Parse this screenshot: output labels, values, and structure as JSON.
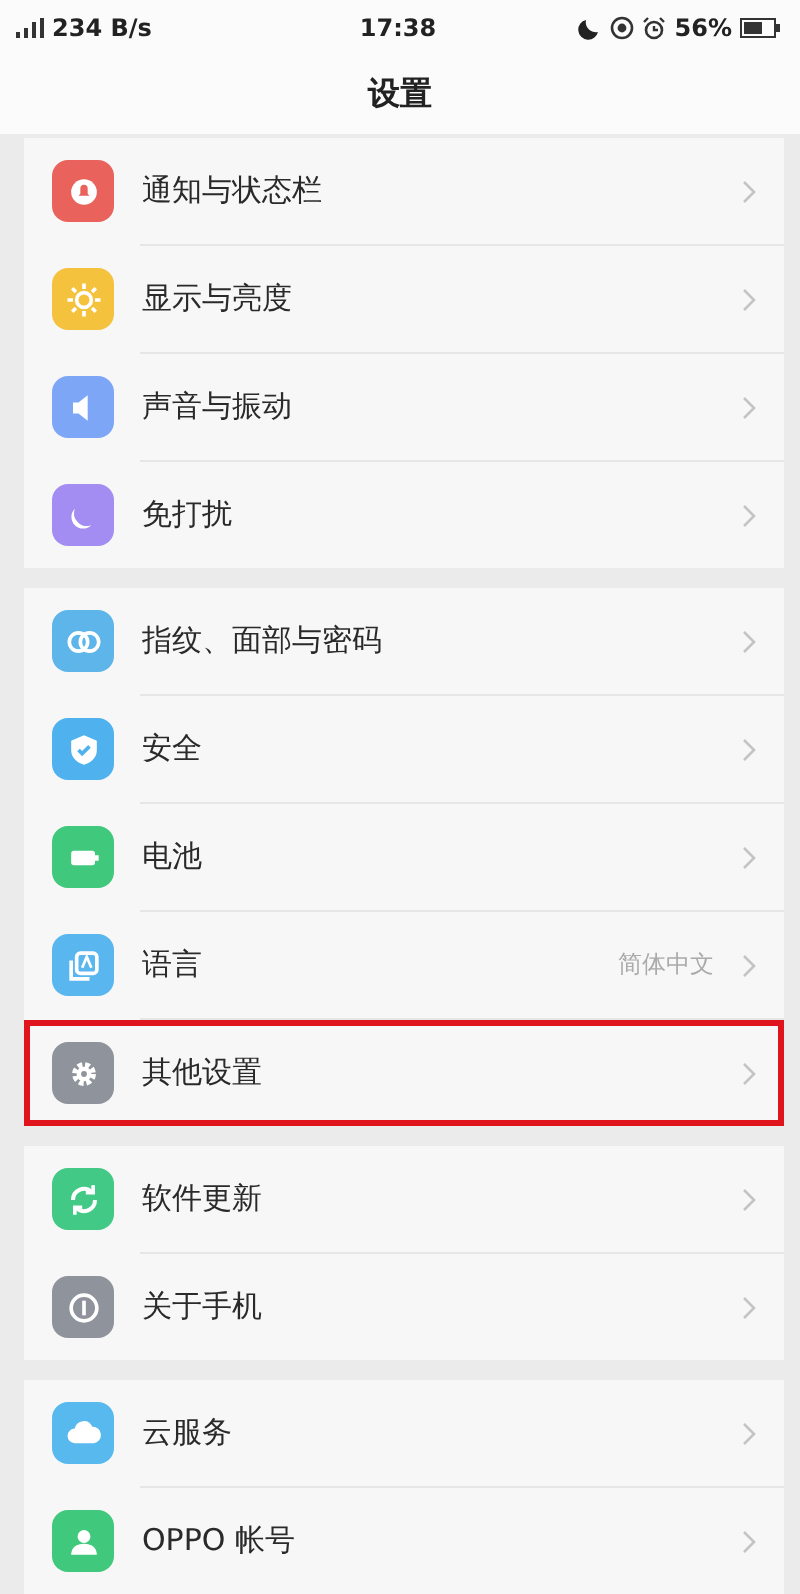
{
  "status_bar": {
    "speed": "234 B/s",
    "time": "17:38",
    "battery": "56%"
  },
  "header": {
    "title": "设置"
  },
  "groups": [
    [
      {
        "kind": "bell",
        "label": "通知与状态栏",
        "color": "#e9625b",
        "highlighted": false
      },
      {
        "kind": "sun",
        "label": "显示与亮度",
        "color": "#f4c23c",
        "highlighted": false
      },
      {
        "kind": "speaker",
        "label": "声音与振动",
        "color": "#7da7f6",
        "highlighted": false
      },
      {
        "kind": "moon",
        "label": "免打扰",
        "color": "#a38df2",
        "highlighted": false
      }
    ],
    [
      {
        "kind": "face",
        "label": "指纹、面部与密码",
        "color": "#5db5ea",
        "highlighted": false
      },
      {
        "kind": "shield",
        "label": "安全",
        "color": "#4fb2ef",
        "highlighted": false
      },
      {
        "kind": "battery",
        "label": "电池",
        "color": "#40c87c",
        "highlighted": false
      },
      {
        "kind": "language",
        "label": "语言",
        "value": "简体中文",
        "color": "#5ab6ee",
        "highlighted": false
      },
      {
        "kind": "gear",
        "label": "其他设置",
        "color": "#8f949c",
        "highlighted": true
      }
    ],
    [
      {
        "kind": "sync",
        "label": "软件更新",
        "color": "#42c986",
        "highlighted": false
      },
      {
        "kind": "info",
        "label": "关于手机",
        "color": "#8f949c",
        "highlighted": false
      }
    ],
    [
      {
        "kind": "cloud",
        "label": "云服务",
        "color": "#58b9ef",
        "highlighted": false
      },
      {
        "kind": "person",
        "label": "OPPO 帐号",
        "color": "#40c87c",
        "highlighted": false
      }
    ]
  ]
}
